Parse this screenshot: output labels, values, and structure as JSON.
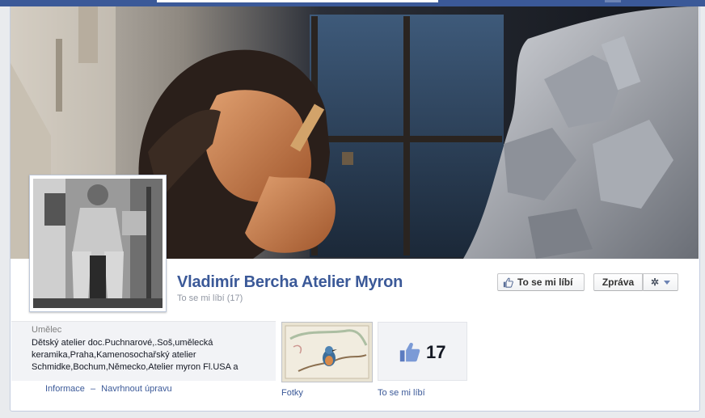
{
  "page": {
    "name": "Vladimír Bercha Atelier Myron",
    "likes_summary": "To se mi líbí (17)"
  },
  "actions": {
    "like_label": "To se mi líbí",
    "message_label": "Zpráva",
    "settings_icon": "gear-icon"
  },
  "about": {
    "category": "Umělec",
    "text": "Dětský atelier doc.Puchnarové,.Soš,umělecká keramika,Praha,Kamenosochařský atelier Schmidke,Bochum,Německo,Atelier myron Fl.USA a",
    "info_link": "Informace",
    "separator": "–",
    "suggest_link": "Navrhnout úpravu"
  },
  "apps": [
    {
      "label": "Fotky"
    },
    {
      "label": "To se mi líbí",
      "count": "17"
    }
  ],
  "colors": {
    "brand": "#3b5998",
    "link": "#3b5998",
    "page_background": "#e9ebee"
  }
}
